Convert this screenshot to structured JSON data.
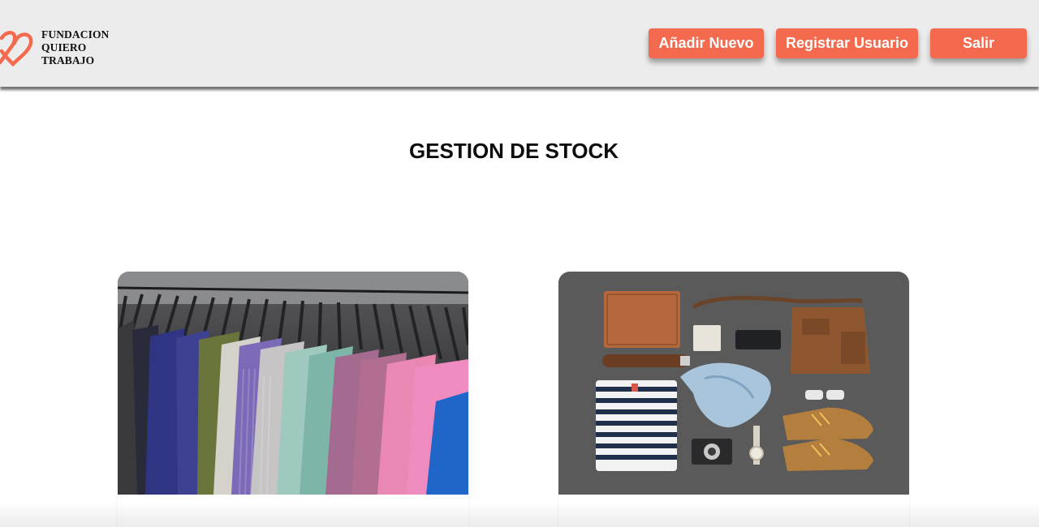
{
  "header": {
    "logo": {
      "line1": "FUNDACION",
      "line2": "QUIERO",
      "line3": "TRABAJO",
      "icon": "heart-logo-icon",
      "accent_color": "#f36a4e"
    },
    "buttons": {
      "add_new": "Añadir Nuevo",
      "register_user": "Registrar Usuario",
      "logout": "Salir"
    },
    "button_color": "#f36a4e"
  },
  "main": {
    "title": "GESTION DE STOCK",
    "cards": [
      {
        "image": "clothing-rack-photo"
      },
      {
        "image": "accessories-flatlay-photo"
      }
    ]
  }
}
